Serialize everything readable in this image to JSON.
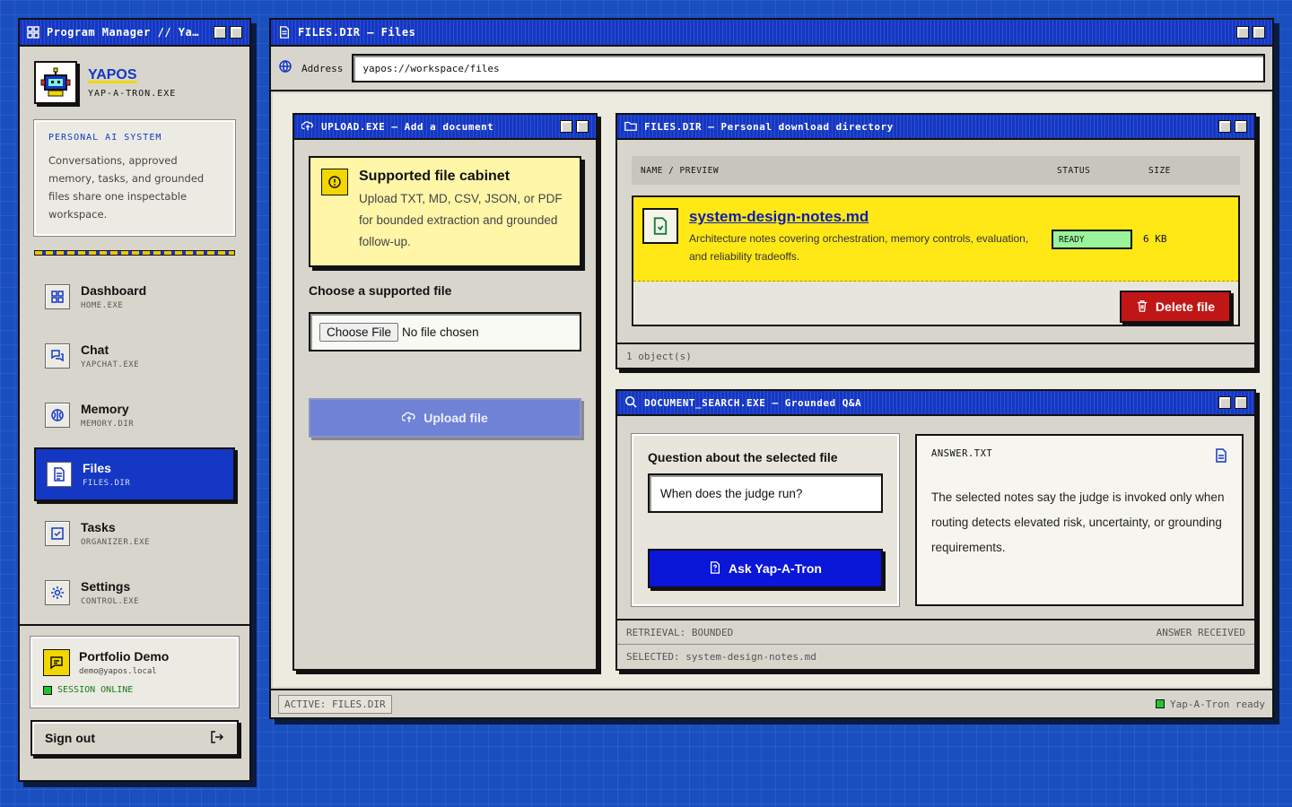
{
  "program_manager": {
    "title": "Program Manager // Ya…",
    "brand_name": "YAPOS",
    "brand_sub": "YAP-A-TRON.EXE",
    "system_heading": "PERSONAL AI SYSTEM",
    "system_text": "Conversations, approved memory, tasks, and grounded files share one inspectable workspace.",
    "nav": [
      {
        "label": "Dashboard",
        "sub": "HOME.EXE",
        "icon": "grid-icon"
      },
      {
        "label": "Chat",
        "sub": "YAPCHAT.EXE",
        "icon": "chat-icon"
      },
      {
        "label": "Memory",
        "sub": "MEMORY.DIR",
        "icon": "brain-icon"
      },
      {
        "label": "Files",
        "sub": "FILES.DIR",
        "icon": "file-icon",
        "active": true
      },
      {
        "label": "Tasks",
        "sub": "ORGANIZER.EXE",
        "icon": "checkbox-icon"
      },
      {
        "label": "Settings",
        "sub": "CONTROL.EXE",
        "icon": "gear-icon"
      }
    ],
    "user": {
      "name": "Portfolio Demo",
      "email": "demo@yapos.local",
      "session": "SESSION ONLINE"
    },
    "sign_out": "Sign out"
  },
  "main": {
    "title": "FILES.DIR — Files",
    "address_label": "Address",
    "address_value": "yapos://workspace/files",
    "status_active": "ACTIVE: FILES.DIR",
    "status_ready": "Yap-A-Tron ready"
  },
  "upload": {
    "title": "UPLOAD.EXE — Add a document",
    "note_heading": "Supported file cabinet",
    "note_text": "Upload TXT, MD, CSV, JSON, or PDF for bounded extraction and grounded follow-up.",
    "choose_label": "Choose a supported file",
    "choose_button": "Choose File",
    "no_file": "No file chosen",
    "upload_button": "Upload file"
  },
  "files_dir": {
    "title": "FILES.DIR — Personal download directory",
    "columns": [
      "NAME / PREVIEW",
      "STATUS",
      "SIZE"
    ],
    "files": [
      {
        "name": "system-design-notes.md",
        "description": "Architecture notes covering orchestration, memory controls, evaluation, and reliability tradeoffs.",
        "status": "READY",
        "size": "6 KB"
      }
    ],
    "delete_button": "Delete file",
    "footer": "1 object(s)"
  },
  "search": {
    "title": "DOCUMENT_SEARCH.EXE — Grounded Q&A",
    "question_label": "Question about the selected file",
    "question_value": "When does the judge run?",
    "ask_button": "Ask Yap-A-Tron",
    "answer_heading": "ANSWER.TXT",
    "answer_text": "The selected notes say the judge is invoked only when routing detects elevated risk, uncertainty, or grounding requirements.",
    "retrieval": "RETRIEVAL: BOUNDED",
    "answer_status": "ANSWER RECEIVED",
    "selected": "SELECTED: system-design-notes.md"
  }
}
